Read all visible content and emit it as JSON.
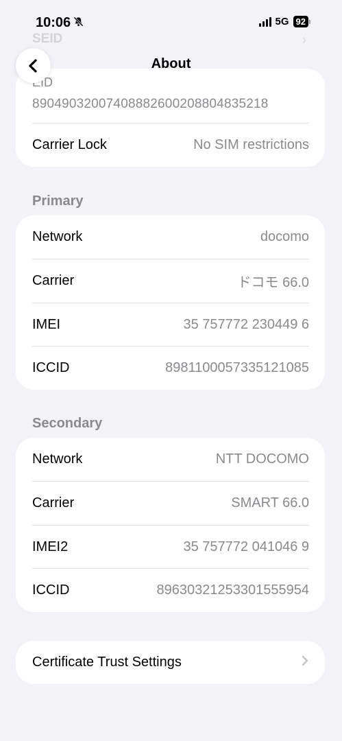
{
  "status_bar": {
    "time": "10:06",
    "network": "5G",
    "battery": "92"
  },
  "background_ghost": {
    "seid_label": "SEID"
  },
  "nav": {
    "title": "About"
  },
  "top_card": {
    "eid_label": "EID",
    "eid_value": "89049032007408882600208804835218",
    "carrier_lock_label": "Carrier Lock",
    "carrier_lock_value": "No SIM restrictions"
  },
  "primary": {
    "header": "Primary",
    "rows": [
      {
        "label": "Network",
        "value": "docomo"
      },
      {
        "label": "Carrier",
        "value": "ドコモ 66.0"
      },
      {
        "label": "IMEI",
        "value": "35 757772 230449 6"
      },
      {
        "label": "ICCID",
        "value": "8981100057335121085"
      }
    ]
  },
  "secondary": {
    "header": "Secondary",
    "rows": [
      {
        "label": "Network",
        "value": "NTT DOCOMO"
      },
      {
        "label": "Carrier",
        "value": "SMART 66.0"
      },
      {
        "label": "IMEI2",
        "value": "35 757772 041046 9"
      },
      {
        "label": "ICCID",
        "value": "89630321253301555954"
      }
    ]
  },
  "certificate": {
    "label": "Certificate Trust Settings"
  },
  "colors": {
    "background": "#f2f2f7",
    "card": "#ffffff",
    "secondary_text": "#8a8a8e"
  }
}
